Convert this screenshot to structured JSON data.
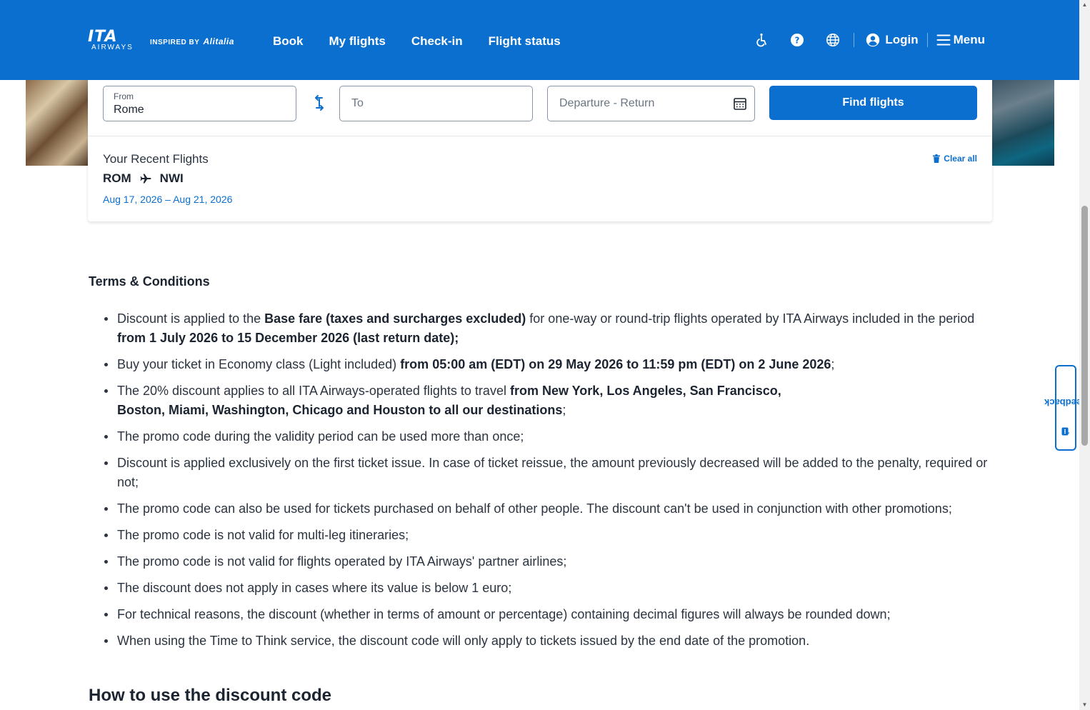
{
  "header": {
    "logo_text": "ITA",
    "logo_sub": "AIRWAYS",
    "inspired_by": "INSPIRED BY",
    "inspired_brand": "Alitalia",
    "nav": [
      "Book",
      "My flights",
      "Check-in",
      "Flight status"
    ],
    "login_label": "Login",
    "menu_label": "Menu",
    "icons": [
      "accessibility-icon",
      "help-icon",
      "globe-icon",
      "user-icon",
      "hamburger-icon"
    ]
  },
  "search": {
    "from_label": "From",
    "from_value": "Rome",
    "to_placeholder": "To",
    "dates_placeholder": "Departure - Return",
    "find_label": "Find flights",
    "recent_title": "Your Recent Flights",
    "clear_all_label": "Clear all",
    "recent": {
      "origin": "ROM",
      "destination": "NWI",
      "dates": "Aug 17, 2026 – Aug 21, 2026"
    }
  },
  "terms": {
    "title": "Terms & Conditions",
    "items": [
      [
        {
          "t": "Discount is applied to the "
        },
        {
          "t": "Base fare (taxes and surcharges excluded)",
          "b": true
        },
        {
          "t": " for one-way or round-trip flights operated by ITA Airways included in the period "
        },
        {
          "t": "from 1 July 2026 to 15 December 2026 (last return date);",
          "b": true
        }
      ],
      [
        {
          "t": "Buy your ticket in Economy class (Light included) "
        },
        {
          "t": "from 05:00 am (EDT) on 29 May 2026 to 11:59 pm (EDT) on 2 June 2026",
          "b": true
        },
        {
          "t": ";"
        }
      ],
      [
        {
          "t": "The 20% discount applies to all ITA Airways-operated flights to travel "
        },
        {
          "t": "from New York, Los Angeles, San Francisco,",
          "b": true
        },
        {
          "br": true
        },
        {
          "t": "Boston, Miami, Washington, Chicago and Houston to all our destinations",
          "b": true
        },
        {
          "t": ";"
        }
      ],
      [
        {
          "t": "The promo code during the validity period can be used more than once;"
        }
      ],
      [
        {
          "t": "Discount is applied exclusively on the first ticket issue. In case of ticket reissue,  the amount previously decreased will be added to the penalty, required or not;"
        }
      ],
      [
        {
          "t": "The promo code can also be used for tickets purchased on behalf of other people. The discount can't be used in conjunction with other promotions;"
        }
      ],
      [
        {
          "t": "The promo code is not valid for multi-leg itineraries;"
        }
      ],
      [
        {
          "t": "The promo code is not valid for flights operated by ITA Airways' partner airlines;"
        }
      ],
      [
        {
          "t": "The discount does not apply in cases where its value is below 1 euro;"
        }
      ],
      [
        {
          "t": "For technical reasons, the discount (whether in terms of amount or percentage) containing decimal figures will always be rounded down;"
        }
      ],
      [
        {
          "t": " When using the Time to Think service, the discount code will only apply to tickets issued by the end date of the promotion."
        }
      ]
    ]
  },
  "how_title": "How to use the discount code",
  "feedback_label": "Feedback",
  "colors": {
    "brand": "#0b6fcf",
    "text": "#1b2430"
  }
}
